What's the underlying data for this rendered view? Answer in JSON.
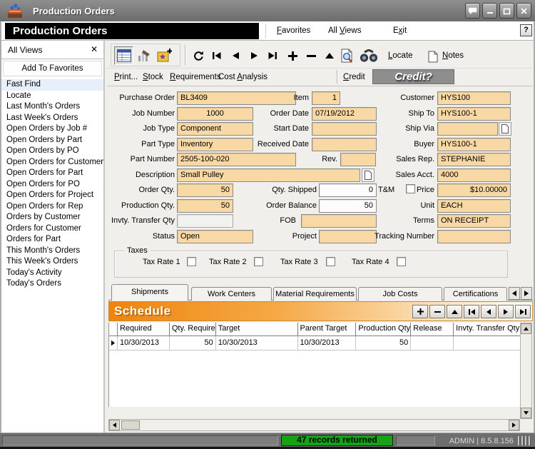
{
  "window": {
    "title": "Production Orders"
  },
  "menu": {
    "box_title": "Production Orders",
    "items": [
      {
        "pre": "",
        "key": "F",
        "post": "avorites"
      },
      {
        "pre": "All ",
        "key": "V",
        "post": "iews"
      },
      {
        "pre": "E",
        "key": "x",
        "post": "it"
      }
    ],
    "help": "?"
  },
  "sidebar": {
    "header": "All Views",
    "close": "✕",
    "add_favorites": "Add To Favorites",
    "selected_index": 0,
    "items": [
      "Fast Find",
      "Locate",
      "Last Month's Orders",
      "Last Week's Orders",
      "Open Orders by Job #",
      "Open Orders by Part",
      "Open Orders by PO",
      "Open Orders for Customer",
      "Open Orders for Part",
      "Open Orders for PO",
      "Open Orders for Project",
      "Open Orders for Rep",
      "Orders by Customer",
      "Orders for Customer",
      "Orders for Part",
      "This Month's Orders",
      "This Week's Orders",
      "Today's Activity",
      "Today's Orders"
    ]
  },
  "toolbar": {
    "locate": {
      "pre": "",
      "key": "L",
      "post": "ocate"
    },
    "notes": {
      "pre": "",
      "key": "N",
      "post": "otes"
    }
  },
  "actionbar": {
    "print": {
      "pre": "",
      "key": "P",
      "post": "rint..."
    },
    "stock": {
      "pre": "",
      "key": "S",
      "post": "tock"
    },
    "requirements": {
      "pre": "",
      "key": "R",
      "post": "equirements"
    },
    "cost_analysis": {
      "pre": "Cost ",
      "key": "A",
      "post": "nalysis"
    },
    "credit": {
      "pre": "",
      "key": "C",
      "post": "redit"
    },
    "credit_button": "Credit?"
  },
  "form": {
    "purchase_order": {
      "label": "Purchase Order",
      "value": "BL3409"
    },
    "item": {
      "label": "Item",
      "value": "1"
    },
    "customer": {
      "label": "Customer",
      "value": "HYS100"
    },
    "job_number": {
      "label": "Job Number",
      "value": "1000"
    },
    "order_date": {
      "label": "Order Date",
      "value": "07/19/2012"
    },
    "ship_to": {
      "label": "Ship To",
      "value": "HYS100-1"
    },
    "job_type": {
      "label": "Job Type",
      "value": "Component"
    },
    "start_date": {
      "label": "Start Date",
      "value": ""
    },
    "ship_via": {
      "label": "Ship Via",
      "value": ""
    },
    "part_type": {
      "label": "Part Type",
      "value": "Inventory"
    },
    "received_date": {
      "label": "Received Date",
      "value": ""
    },
    "buyer": {
      "label": "Buyer",
      "value": "HYS100-1"
    },
    "part_number": {
      "label": "Part Number",
      "value": "2505-100-020"
    },
    "rev": {
      "label": "Rev.",
      "value": ""
    },
    "sales_rep": {
      "label": "Sales Rep.",
      "value": "STEPHANIE"
    },
    "description": {
      "label": "Description",
      "value": "Small Pulley"
    },
    "sales_acct": {
      "label": "Sales Acct.",
      "value": "4000"
    },
    "order_qty": {
      "label": "Order Qty.",
      "value": "50"
    },
    "qty_shipped": {
      "label": "Qty. Shipped",
      "value": "0"
    },
    "tm": {
      "label": "T&M"
    },
    "price": {
      "label": "Price",
      "value": "$10.00000"
    },
    "production_qty": {
      "label": "Production Qty.",
      "value": "50"
    },
    "order_balance": {
      "label": "Order Balance",
      "value": "50"
    },
    "unit": {
      "label": "Unit",
      "value": "EACH"
    },
    "invty_transfer_qty": {
      "label": "Invty. Transfer Qty",
      "value": ""
    },
    "fob": {
      "label": "FOB",
      "value": ""
    },
    "terms": {
      "label": "Terms",
      "value": "ON RECEIPT"
    },
    "status": {
      "label": "Status",
      "value": "Open"
    },
    "project": {
      "label": "Project",
      "value": ""
    },
    "tracking_number": {
      "label": "Tracking Number",
      "value": ""
    }
  },
  "taxes": {
    "title": "Taxes",
    "items": [
      "Tax Rate 1",
      "Tax Rate 2",
      "Tax Rate 3",
      "Tax Rate 4"
    ]
  },
  "tabs": [
    "Shipments",
    "Work Centers",
    "Material Requirements",
    "Job Costs",
    "Certifications"
  ],
  "schedule": {
    "title": "Schedule"
  },
  "grid": {
    "columns": [
      "Required",
      "Qty. Required",
      "Target",
      "Parent Target",
      "Production Qty",
      "Release",
      "Invty. Transfer Qty"
    ],
    "rows": [
      {
        "required": "10/30/2013",
        "qty_required": "50",
        "target": "10/30/2013",
        "parent_target": "10/30/2013",
        "production_qty": "50",
        "release": "",
        "invty_transfer_qty": ""
      }
    ]
  },
  "statusbar": {
    "records": "47 records returned",
    "user": "ADMIN | 8.5.8.156"
  },
  "colors": {
    "field_peach": "#F8D8A4",
    "schedule_orange": "#EE850E",
    "status_green": "#17A117"
  }
}
